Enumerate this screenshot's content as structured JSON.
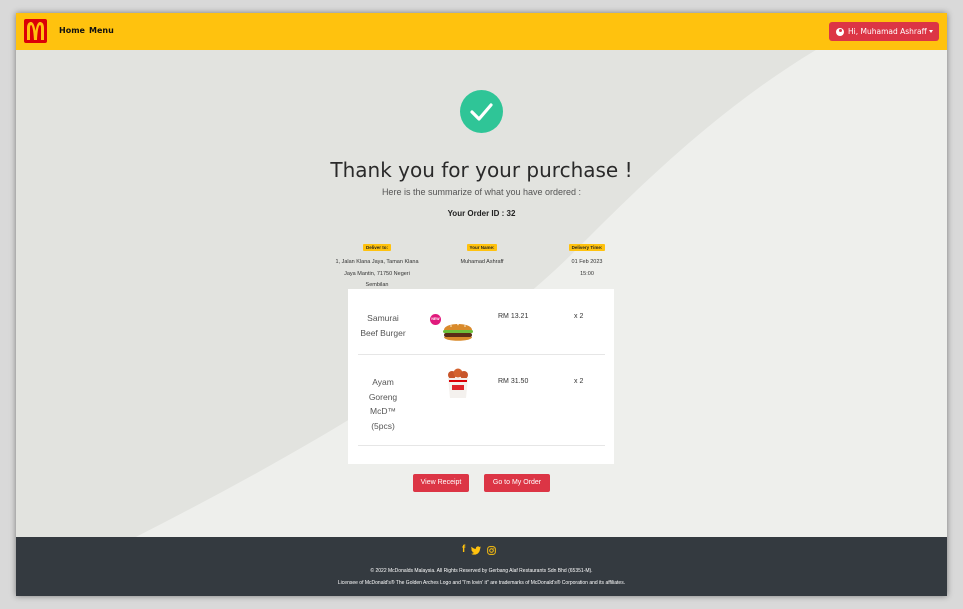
{
  "colors": {
    "navbar": "#ffc20e",
    "accent_red": "#dc3545",
    "success_green": "#2fc597",
    "footer_bg": "#343a40",
    "badge_pink": "#e0197c"
  },
  "navbar": {
    "logo_icon": "golden-arches-icon",
    "links": [
      "Home",
      "Menu"
    ],
    "user_button": "Hi, Muhamad Ashraff"
  },
  "confirmation": {
    "icon": "check-circle-icon",
    "title": "Thank you for your purchase !",
    "subtitle": "Here is the summarize of what you have ordered :",
    "order_id": "Your Order ID : 32"
  },
  "details": {
    "deliver_to": {
      "label": "Deliver to:",
      "lines": [
        "1, Jalan Klana Jaya, Taman Klana",
        "Jaya Mantin, 71750 Negeri",
        "Sembilan"
      ]
    },
    "your_name": {
      "label": "Your Name:",
      "value": "Muhamad Ashraff"
    },
    "delivery_time": {
      "label": "Delivery Time:",
      "lines": [
        "01 Feb 2023",
        "15:00"
      ]
    }
  },
  "order_items": [
    {
      "name_lines": [
        "Samurai",
        "Beef Burger"
      ],
      "badge": "NEW",
      "image_icon": "burger-icon",
      "price": "RM 13.21",
      "qty": "x 2"
    },
    {
      "name_lines": [
        "Ayam",
        "Goreng",
        "McD™",
        "(5pcs)"
      ],
      "image_icon": "fried-chicken-bucket-icon",
      "price": "RM 31.50",
      "qty": "x 2"
    }
  ],
  "actions": {
    "view_receipt": "View Receipt",
    "go_to_order": "Go to My Order"
  },
  "footer": {
    "social_icons": [
      "facebook-icon",
      "twitter-icon",
      "instagram-icon"
    ],
    "copyright": "© 2022 McDonalds Malaysia. All Rights Reserved by Gerbang Alaf Restaurants Sdn Bhd (65351-M).",
    "license": "Licensee of McDonald's® The Golden Arches Logo and \"I'm lovin' it\" are trademarks of McDonald's® Corporation and its affiliates."
  }
}
